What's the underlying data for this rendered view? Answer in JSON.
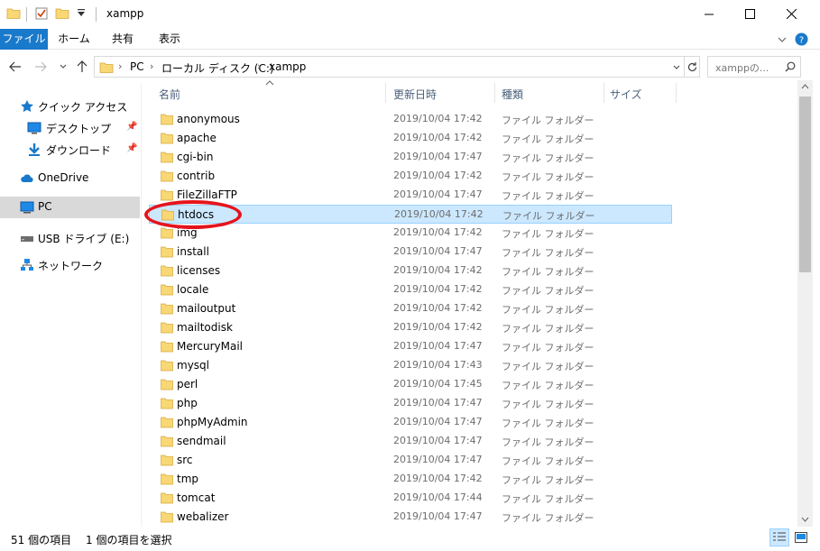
{
  "window": {
    "title": "xampp",
    "controls": {
      "minimize": "—",
      "maximize": "☐",
      "close": "✕"
    }
  },
  "ribbon": {
    "tabs": [
      "ファイル",
      "ホーム",
      "共有",
      "表示"
    ],
    "expand_icon": "chevron-down-icon",
    "help_icon": "help-icon"
  },
  "address": {
    "crumbs": [
      "PC",
      "ローカル ディスク (C:)",
      "xampp"
    ],
    "search_placeholder": "xamppの..."
  },
  "nav": {
    "items": [
      {
        "label": "クイック アクセス",
        "icon": "star-icon"
      },
      {
        "label": "デスクトップ",
        "icon": "desktop-icon",
        "pinned": true
      },
      {
        "label": "ダウンロード",
        "icon": "download-icon",
        "pinned": true
      },
      {
        "label": "OneDrive",
        "icon": "cloud-icon"
      },
      {
        "label": "PC",
        "icon": "pc-icon",
        "selected": true
      },
      {
        "label": "USB ドライブ (E:)",
        "icon": "usb-drive-icon"
      },
      {
        "label": "ネットワーク",
        "icon": "network-icon"
      }
    ]
  },
  "columns": {
    "name": "名前",
    "date": "更新日時",
    "type": "種類",
    "size": "サイズ"
  },
  "files": [
    {
      "name": "anonymous",
      "date": "2019/10/04 17:42",
      "type": "ファイル フォルダー"
    },
    {
      "name": "apache",
      "date": "2019/10/04 17:42",
      "type": "ファイル フォルダー"
    },
    {
      "name": "cgi-bin",
      "date": "2019/10/04 17:47",
      "type": "ファイル フォルダー"
    },
    {
      "name": "contrib",
      "date": "2019/10/04 17:42",
      "type": "ファイル フォルダー"
    },
    {
      "name": "FileZillaFTP",
      "date": "2019/10/04 17:47",
      "type": "ファイル フォルダー"
    },
    {
      "name": "htdocs",
      "date": "2019/10/04 17:42",
      "type": "ファイル フォルダー",
      "selected": true
    },
    {
      "name": "img",
      "date": "2019/10/04 17:42",
      "type": "ファイル フォルダー"
    },
    {
      "name": "install",
      "date": "2019/10/04 17:47",
      "type": "ファイル フォルダー"
    },
    {
      "name": "licenses",
      "date": "2019/10/04 17:42",
      "type": "ファイル フォルダー"
    },
    {
      "name": "locale",
      "date": "2019/10/04 17:42",
      "type": "ファイル フォルダー"
    },
    {
      "name": "mailoutput",
      "date": "2019/10/04 17:42",
      "type": "ファイル フォルダー"
    },
    {
      "name": "mailtodisk",
      "date": "2019/10/04 17:42",
      "type": "ファイル フォルダー"
    },
    {
      "name": "MercuryMail",
      "date": "2019/10/04 17:47",
      "type": "ファイル フォルダー"
    },
    {
      "name": "mysql",
      "date": "2019/10/04 17:43",
      "type": "ファイル フォルダー"
    },
    {
      "name": "perl",
      "date": "2019/10/04 17:45",
      "type": "ファイル フォルダー"
    },
    {
      "name": "php",
      "date": "2019/10/04 17:47",
      "type": "ファイル フォルダー"
    },
    {
      "name": "phpMyAdmin",
      "date": "2019/10/04 17:47",
      "type": "ファイル フォルダー"
    },
    {
      "name": "sendmail",
      "date": "2019/10/04 17:47",
      "type": "ファイル フォルダー"
    },
    {
      "name": "src",
      "date": "2019/10/04 17:47",
      "type": "ファイル フォルダー"
    },
    {
      "name": "tmp",
      "date": "2019/10/04 17:42",
      "type": "ファイル フォルダー"
    },
    {
      "name": "tomcat",
      "date": "2019/10/04 17:44",
      "type": "ファイル フォルダー"
    },
    {
      "name": "webalizer",
      "date": "2019/10/04 17:47",
      "type": "ファイル フォルダー"
    }
  ],
  "status": {
    "item_count": "51 個の項目",
    "selected_count": "1 個の項目を選択"
  },
  "colors": {
    "accent": "#1979ca",
    "selection_bg": "#cce8ff",
    "selection_border": "#99d1ff",
    "folder": "#f8d775",
    "annotation": "#e5141c"
  }
}
